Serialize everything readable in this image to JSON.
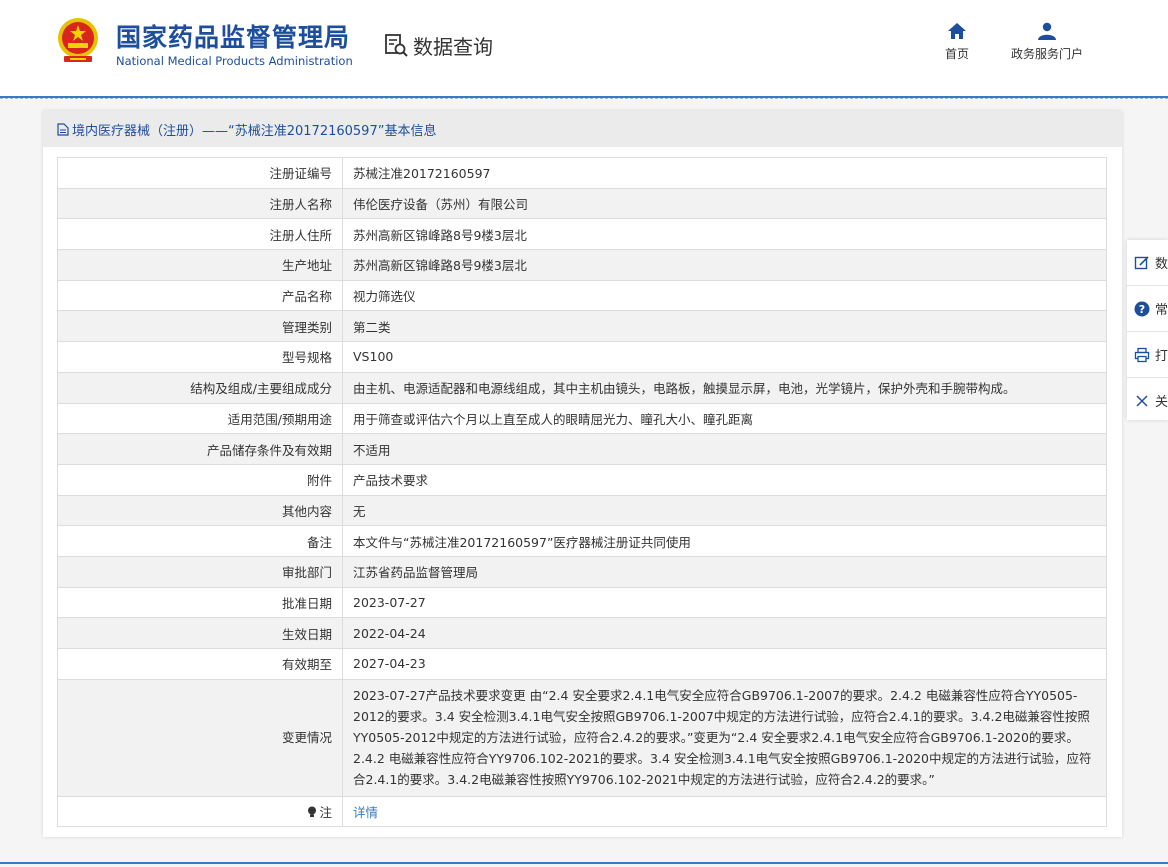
{
  "header": {
    "title_cn": "国家药品监督管理局",
    "title_en": "National Medical Products Administration",
    "query_label": "数据查询",
    "nav": [
      {
        "label": "首页",
        "icon": "home-icon"
      },
      {
        "label": "政务服务门户",
        "icon": "user-icon"
      }
    ]
  },
  "panel": {
    "title": "境内医疗器械（注册）——“苏械注准20172160597”基本信息"
  },
  "rows": [
    {
      "key": "注册证编号",
      "value": "苏械注准20172160597"
    },
    {
      "key": "注册人名称",
      "value": "伟伦医疗设备（苏州）有限公司"
    },
    {
      "key": "注册人住所",
      "value": "苏州高新区锦峰路8号9楼3层北"
    },
    {
      "key": "生产地址",
      "value": "苏州高新区锦峰路8号9楼3层北"
    },
    {
      "key": "产品名称",
      "value": "视力筛选仪"
    },
    {
      "key": "管理类别",
      "value": "第二类"
    },
    {
      "key": "型号规格",
      "value": "VS100"
    },
    {
      "key": "结构及组成/主要组成成分",
      "value": "由主机、电源适配器和电源线组成，其中主机由镜头，电路板，触摸显示屏，电池，光学镜片，保护外壳和手腕带构成。"
    },
    {
      "key": "适用范围/预期用途",
      "value": "用于筛查或评估六个月以上直至成人的眼睛屈光力、瞳孔大小、瞳孔距离"
    },
    {
      "key": "产品储存条件及有效期",
      "value": "不适用"
    },
    {
      "key": "附件",
      "value": "产品技术要求"
    },
    {
      "key": "其他内容",
      "value": "无"
    },
    {
      "key": "备注",
      "value": "本文件与“苏械注准20172160597”医疗器械注册证共同使用"
    },
    {
      "key": "审批部门",
      "value": "江苏省药品监督管理局"
    },
    {
      "key": "批准日期",
      "value": "2023-07-27"
    },
    {
      "key": "生效日期",
      "value": "2022-04-24"
    },
    {
      "key": "有效期至",
      "value": "2027-04-23"
    },
    {
      "key": "变更情况",
      "value": "2023-07-27产品技术要求变更 由“2.4 安全要求2.4.1电气安全应符合GB9706.1-2007的要求。2.4.2 电磁兼容性应符合YY0505-2012的要求。3.4 安全检测3.4.1电气安全按照GB9706.1-2007中规定的方法进行试验，应符合2.4.1的要求。3.4.2电磁兼容性按照YY0505-2012中规定的方法进行试验，应符合2.4.2的要求。”变更为“2.4 安全要求2.4.1电气安全应符合GB9706.1-2020的要求。2.4.2 电磁兼容性应符合YY9706.102-2021的要求。3.4 安全检测3.4.1电气安全按照GB9706.1-2020中规定的方法进行试验，应符合2.4.1的要求。3.4.2电磁兼容性按照YY9706.102-2021中规定的方法进行试验，应符合2.4.2的要求。”"
    }
  ],
  "note": {
    "key": "注",
    "link": "详情"
  },
  "float_menu": [
    {
      "label": "数",
      "icon": "edit-icon"
    },
    {
      "label": "常",
      "icon": "help-icon"
    },
    {
      "label": "打",
      "icon": "print-icon"
    },
    {
      "label": "关",
      "icon": "close-icon"
    }
  ],
  "colors": {
    "brand": "#1d4e9c",
    "accent": "#3a7bbf"
  }
}
